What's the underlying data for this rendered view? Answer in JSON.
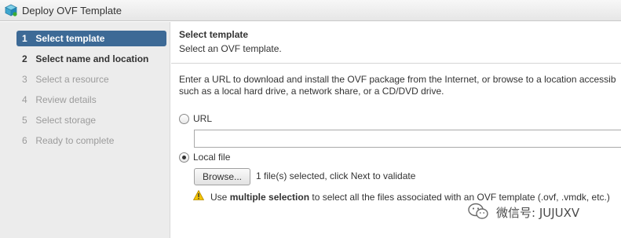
{
  "window": {
    "title": "Deploy OVF Template",
    "icon": "ovf-template-icon"
  },
  "sidebar": {
    "steps": [
      {
        "num": "1",
        "label": "Select template",
        "state": "active"
      },
      {
        "num": "2",
        "label": "Select name and location",
        "state": "done"
      },
      {
        "num": "3",
        "label": "Select a resource",
        "state": "disabled"
      },
      {
        "num": "4",
        "label": "Review details",
        "state": "disabled"
      },
      {
        "num": "5",
        "label": "Select storage",
        "state": "disabled"
      },
      {
        "num": "6",
        "label": "Ready to complete",
        "state": "disabled"
      }
    ]
  },
  "main": {
    "title": "Select template",
    "subtitle": "Select an OVF template.",
    "description_line1": "Enter a URL to download and install the OVF package from the Internet, or browse to a location accessib",
    "description_line2": "such as a local hard drive, a network share, or a CD/DVD drive.",
    "options": {
      "url_label": "URL",
      "url_value": "",
      "url_selected": false,
      "local_label": "Local file",
      "local_selected": true
    },
    "browse_label": "Browse...",
    "file_status": "1 file(s) selected, click Next to validate",
    "warning": {
      "prefix": "Use ",
      "bold": "multiple selection",
      "suffix": " to select all the files associated with an OVF template (.ovf, .vmdk, etc.)"
    }
  },
  "watermark": {
    "text": "微信号: JUJUXV",
    "icon": "wechat-icon"
  },
  "colors": {
    "active_step_bg": "#3d6a96",
    "sidebar_bg": "#ececec",
    "disabled_text": "#9b9b9b",
    "warning_yellow": "#f2c200"
  }
}
